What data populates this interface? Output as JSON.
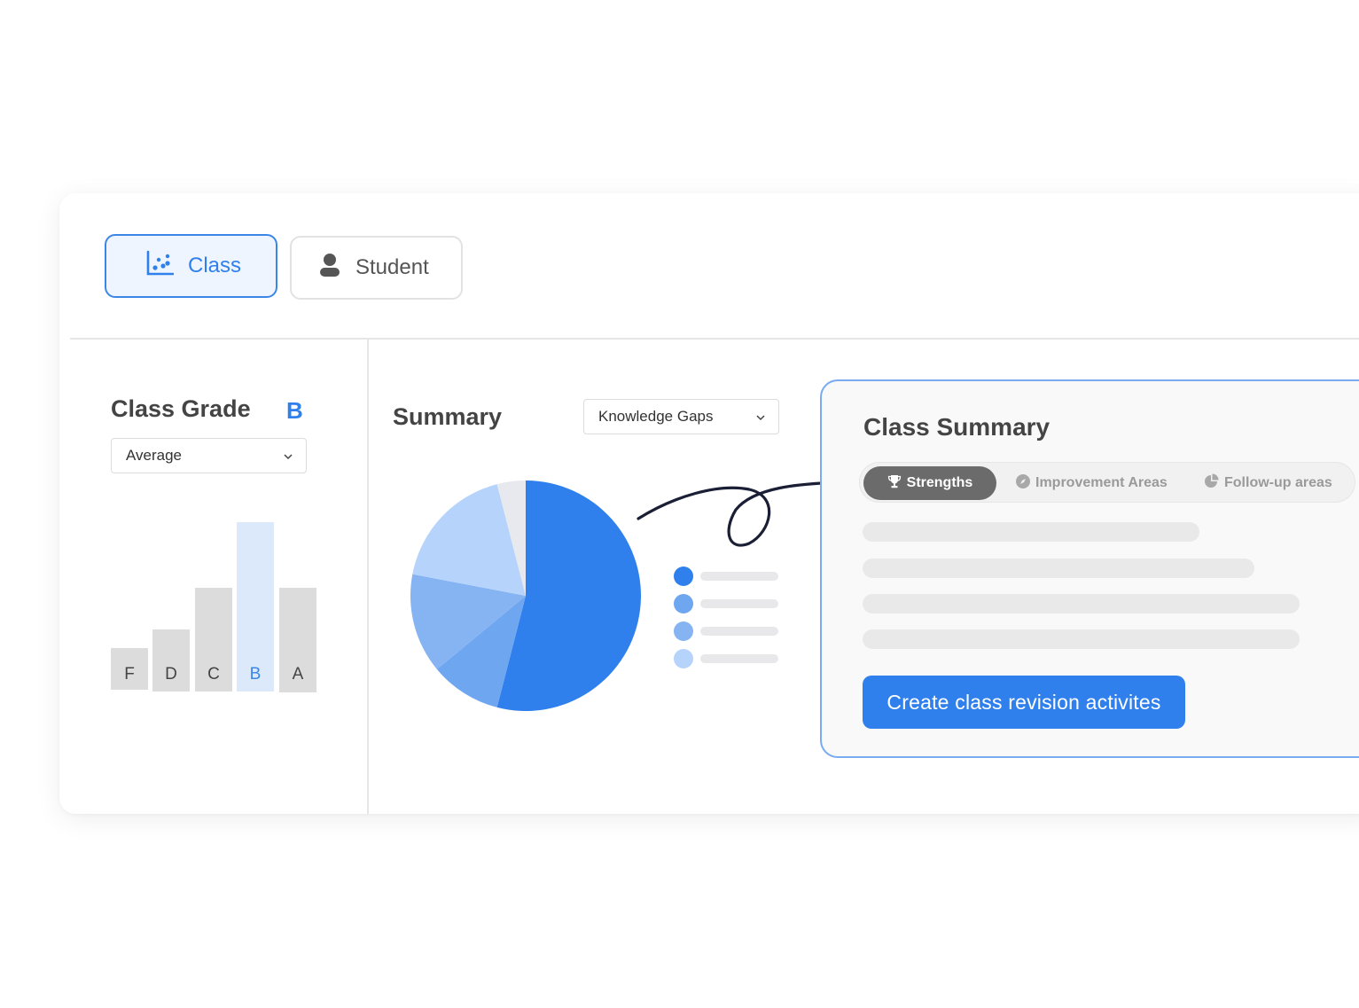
{
  "tabs": {
    "class_label": "Class",
    "student_label": "Student"
  },
  "grade": {
    "title": "Class Grade",
    "letter": "B",
    "select_value": "Average"
  },
  "summary": {
    "title": "Summary",
    "select_value": "Knowledge Gaps"
  },
  "class_summary": {
    "title": "Class Summary",
    "tabs": [
      "Strengths",
      "Improvement Areas",
      "Follow-up areas"
    ],
    "cta_label": "Create class revision activites"
  },
  "colors": {
    "accent": "#2f80ed",
    "pie": [
      "#2f80ed",
      "#6fa6f0",
      "#86b4f3",
      "#b6d4fb",
      "#e8e9ee"
    ],
    "bar": "#dcdcdd",
    "bar_highlight": "#dce9fb"
  },
  "chart_data": [
    {
      "type": "bar",
      "categories": [
        "F",
        "D",
        "C",
        "B",
        "A"
      ],
      "values": [
        47,
        70,
        117,
        191,
        118
      ],
      "highlight": "B",
      "grid": false
    },
    {
      "type": "pie",
      "values": [
        54,
        10,
        14,
        18,
        4
      ],
      "legend_placement": "right"
    }
  ],
  "icons": {
    "class": "scatter-chart-icon",
    "student": "person-icon",
    "strengths": "trophy-icon",
    "improvement": "compass-icon",
    "followup": "pie-chart-icon",
    "dropdown": "chevron-down-icon"
  }
}
